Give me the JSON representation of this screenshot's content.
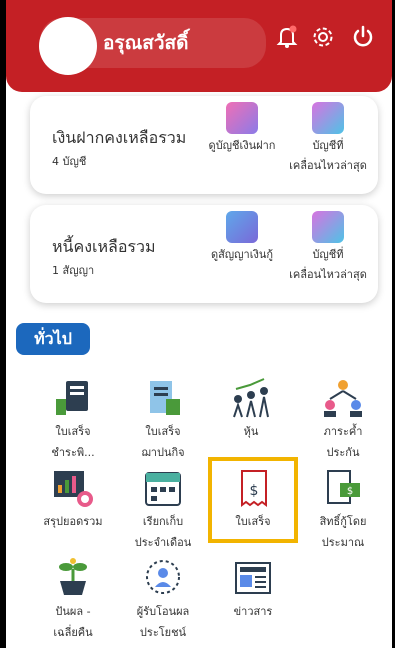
{
  "header": {
    "greeting": "อรุณสวัสดิ์",
    "icons": [
      "bell-icon",
      "settings-icon",
      "power-icon"
    ]
  },
  "deposit_card": {
    "title": "เงินฝากคงเหลือรวม",
    "count": "4 บัญชี",
    "btn1": "ดูบัญชีเงินฝาก",
    "btn2_line1": "บัญชีที่",
    "btn2_line2": "เคลื่อนไหวล่าสุด"
  },
  "loan_card": {
    "title": "หนี้คงเหลือรวม",
    "count": "1 สัญญา",
    "btn1": "ดูสัญญาเงินกู้",
    "btn2_line1": "บัญชีที่",
    "btn2_line2": "เคลื่อนไหวล่าสุด"
  },
  "section_label": "ทั่วไป",
  "menu": [
    {
      "l1": "ใบเสร็จ",
      "l2": "ชำระพิ..."
    },
    {
      "l1": "ใบเสร็จ",
      "l2": "ฌาปนกิจ"
    },
    {
      "l1": "หุ้น",
      "l2": ""
    },
    {
      "l1": "ภาระค้ำ",
      "l2": "ประกัน"
    },
    {
      "l1": "สรุปยอดรวม",
      "l2": ""
    },
    {
      "l1": "เรียกเก็บ",
      "l2": "ประจำเดือน"
    },
    {
      "l1": "ใบเสร็จ",
      "l2": ""
    },
    {
      "l1": "สิทธิ์กู้โดย",
      "l2": "ประมาณ"
    },
    {
      "l1": "ปันผล -",
      "l2": "เฉลี่ยคืน"
    },
    {
      "l1": "ผู้รับโอนผล",
      "l2": "ประโยชน์"
    },
    {
      "l1": "ข่าวสาร",
      "l2": ""
    }
  ],
  "colors": {
    "header": "#c42025",
    "section": "#1c68bd",
    "highlight": "#f2b400"
  }
}
